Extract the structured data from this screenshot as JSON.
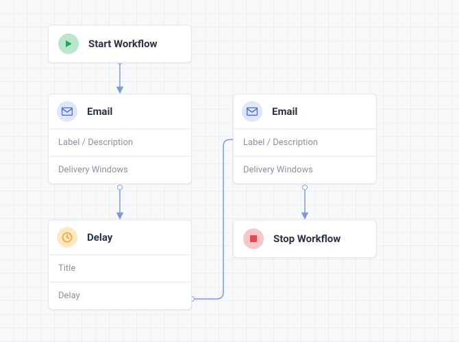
{
  "nodes": {
    "start": {
      "title": "Start Workflow"
    },
    "email1": {
      "title": "Email",
      "row1": "Label / Description",
      "row2": "Delivery Windows"
    },
    "email2": {
      "title": "Email",
      "row1": "Label / Description",
      "row2": "Delivery Windows"
    },
    "delay": {
      "title": "Delay",
      "row1": "Title",
      "row2": "Delay"
    },
    "stop": {
      "title": "Stop Workflow"
    }
  },
  "icons": {
    "start": "play-icon",
    "email": "mail-icon",
    "delay": "clock-icon",
    "stop": "stop-icon"
  },
  "colors": {
    "connector": "#7f97d6",
    "start_icon_bg": "#b9e6cd",
    "start_icon_fg": "#2aa160",
    "email_icon_bg": "#dde6fa",
    "email_icon_fg": "#4a66d6",
    "delay_icon_bg": "#ffe7bf",
    "delay_icon_fg": "#f0a938",
    "stop_icon_bg": "#f8c6c9",
    "stop_icon_fg": "#e0494f"
  },
  "edges": [
    {
      "from": "start",
      "to": "email1"
    },
    {
      "from": "email1",
      "to": "delay"
    },
    {
      "from": "delay",
      "to": "email2"
    },
    {
      "from": "email2",
      "to": "stop"
    }
  ]
}
